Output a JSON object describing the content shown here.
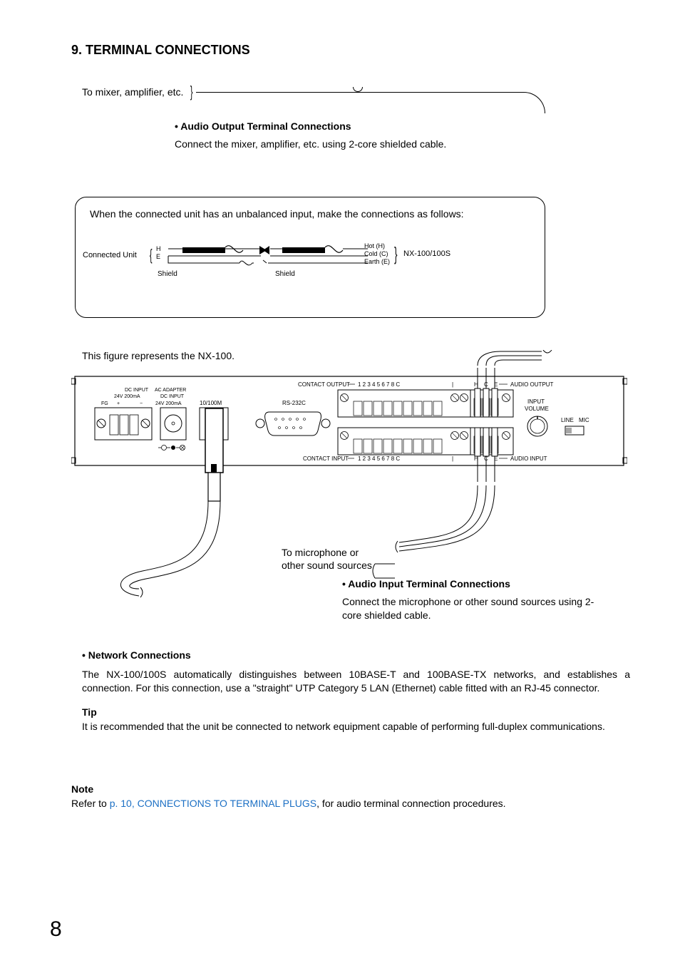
{
  "section_title": "9. TERMINAL CONNECTIONS",
  "mixer_label": "To mixer, amplifier, etc.",
  "audio_output": {
    "heading": "• Audio Output Terminal Connections",
    "body": "Connect the mixer, amplifier, etc. using 2-core shielded cable."
  },
  "unbalanced_box": {
    "text": "When the connected unit has an unbalanced input, make the connections as follows:",
    "connected_unit": "Connected Unit",
    "h": "H",
    "e": "E",
    "hot": "Hot (H)",
    "cold": "Cold (C)",
    "earth": "Earth (E)",
    "nx": "NX-100/100S",
    "shield1": "Shield",
    "shield2": "Shield"
  },
  "fig_caption": "This figure represents the NX-100.",
  "panel": {
    "dc_input": "DC INPUT",
    "ac_adapter": "AC ADAPTER",
    "dc_input2": "DC INPUT",
    "v1": "24V    200mA",
    "v2": "24V    200mA",
    "fg": "FG",
    "plus": "+",
    "minus": "−",
    "net": "10/100M",
    "rs232c": "RS-232C",
    "contact_out": "CONTACT OUTPUT",
    "contact_in": "CONTACT INPUT",
    "nums": "1   2   3   4   5   6   7   8   C",
    "audio_out": "AUDIO OUTPUT",
    "audio_in": "AUDIO INPUT",
    "input_vol": "INPUT\nVOLUME",
    "line": "LINE",
    "mic": "MIC",
    "h": "H",
    "c": "C",
    "e": "E",
    "bar": "|"
  },
  "mic_label": "To microphone or\nother sound sources",
  "audio_input": {
    "heading": "• Audio Input Terminal Connections",
    "body": "Connect the microphone or other sound sources using 2-core shielded cable."
  },
  "network": {
    "heading": "• Network Connections",
    "body": "The NX-100/100S automatically distinguishes between 10BASE-T and 100BASE-TX networks, and establishes a connection. For this connection, use a \"straight\" UTP Category 5 LAN (Ethernet) cable fitted with an RJ-45 connector.",
    "tip_heading": "Tip",
    "tip_body": "It is recommended that the unit be connected to network equipment capable of performing full-duplex communications."
  },
  "note": {
    "heading": "Note",
    "pre": "Refer to ",
    "link": "p. 10, CONNECTIONS TO TERMINAL PLUGS",
    "post": ", for audio terminal connection procedures."
  },
  "page_num": "8"
}
